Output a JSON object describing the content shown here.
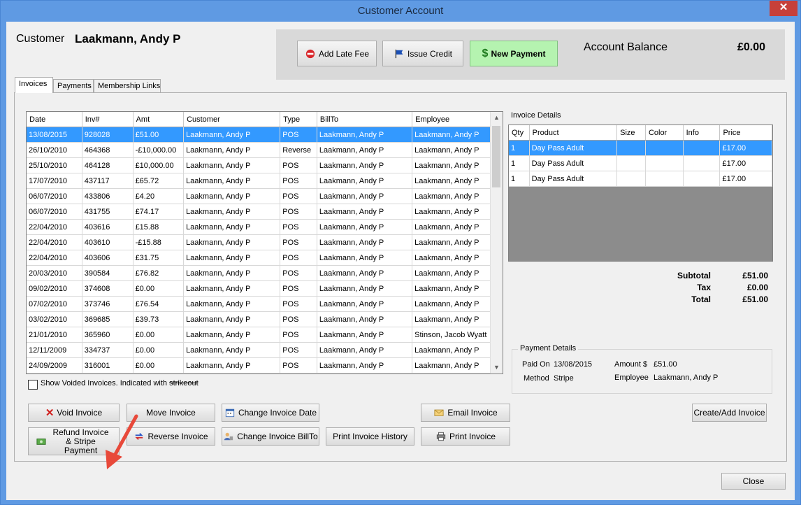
{
  "window": {
    "title": "Customer Account"
  },
  "customer": {
    "label": "Customer",
    "name": "Laakmann, Andy P"
  },
  "toolbar": {
    "add_late_fee": "Add Late Fee",
    "issue_credit": "Issue Credit",
    "new_payment": "New Payment"
  },
  "balance": {
    "label": "Account Balance",
    "value": "£0.00"
  },
  "tabs": [
    {
      "label": "Invoices"
    },
    {
      "label": "Payments"
    },
    {
      "label": "Membership Links"
    }
  ],
  "invoices": {
    "columns": [
      "Date",
      "Inv#",
      "Amt",
      "Customer",
      "Type",
      "BillTo",
      "Employee"
    ],
    "rows": [
      [
        "13/08/2015",
        "928028",
        "£51.00",
        "Laakmann, Andy P",
        "POS",
        "Laakmann, Andy P",
        "Laakmann, Andy P"
      ],
      [
        "26/10/2010",
        "464368",
        "-£10,000.00",
        "Laakmann, Andy P",
        "Reverse",
        "Laakmann, Andy P",
        "Laakmann, Andy P"
      ],
      [
        "25/10/2010",
        "464128",
        "£10,000.00",
        "Laakmann, Andy P",
        "POS",
        "Laakmann, Andy P",
        "Laakmann, Andy P"
      ],
      [
        "17/07/2010",
        "437117",
        "£65.72",
        "Laakmann, Andy P",
        "POS",
        "Laakmann, Andy P",
        "Laakmann, Andy P"
      ],
      [
        "06/07/2010",
        "433806",
        "£4.20",
        "Laakmann, Andy P",
        "POS",
        "Laakmann, Andy P",
        "Laakmann, Andy P"
      ],
      [
        "06/07/2010",
        "431755",
        "£74.17",
        "Laakmann, Andy P",
        "POS",
        "Laakmann, Andy P",
        "Laakmann, Andy P"
      ],
      [
        "22/04/2010",
        "403616",
        "£15.88",
        "Laakmann, Andy P",
        "POS",
        "Laakmann, Andy P",
        "Laakmann, Andy P"
      ],
      [
        "22/04/2010",
        "403610",
        "-£15.88",
        "Laakmann, Andy P",
        "POS",
        "Laakmann, Andy P",
        "Laakmann, Andy P"
      ],
      [
        "22/04/2010",
        "403606",
        "£31.75",
        "Laakmann, Andy P",
        "POS",
        "Laakmann, Andy P",
        "Laakmann, Andy P"
      ],
      [
        "20/03/2010",
        "390584",
        "£76.82",
        "Laakmann, Andy P",
        "POS",
        "Laakmann, Andy P",
        "Laakmann, Andy P"
      ],
      [
        "09/02/2010",
        "374608",
        "£0.00",
        "Laakmann, Andy P",
        "POS",
        "Laakmann, Andy P",
        "Laakmann, Andy P"
      ],
      [
        "07/02/2010",
        "373746",
        "£76.54",
        "Laakmann, Andy P",
        "POS",
        "Laakmann, Andy P",
        "Laakmann, Andy P"
      ],
      [
        "03/02/2010",
        "369685",
        "£39.73",
        "Laakmann, Andy P",
        "POS",
        "Laakmann, Andy P",
        "Laakmann, Andy P"
      ],
      [
        "21/01/2010",
        "365960",
        "£0.00",
        "Laakmann, Andy P",
        "POS",
        "Laakmann, Andy P",
        "Stinson, Jacob Wyatt"
      ],
      [
        "12/11/2009",
        "334737",
        "£0.00",
        "Laakmann, Andy P",
        "POS",
        "Laakmann, Andy P",
        "Laakmann, Andy P"
      ],
      [
        "24/09/2009",
        "316001",
        "£0.00",
        "Laakmann, Andy P",
        "POS",
        "Laakmann, Andy P",
        "Laakmann, Andy P"
      ]
    ]
  },
  "details": {
    "title": "Invoice Details",
    "columns": [
      "Qty",
      "Product",
      "Size",
      "Color",
      "Info",
      "Price"
    ],
    "rows": [
      [
        "1",
        "Day Pass Adult",
        "",
        "",
        "",
        "£17.00"
      ],
      [
        "1",
        "Day Pass Adult",
        "",
        "",
        "",
        "£17.00"
      ],
      [
        "1",
        "Day Pass Adult",
        "",
        "",
        "",
        "£17.00"
      ]
    ]
  },
  "totals": {
    "subtotal_label": "Subtotal",
    "subtotal": "£51.00",
    "tax_label": "Tax",
    "tax": "£0.00",
    "total_label": "Total",
    "total": "£51.00"
  },
  "payment": {
    "legend": "Payment Details",
    "paid_on_label": "Paid On",
    "paid_on": "13/08/2015",
    "amount_label": "Amount $",
    "amount": "£51.00",
    "method_label": "Method",
    "method": "Stripe",
    "employee_label": "Employee",
    "employee": "Laakmann, Andy P"
  },
  "voided": {
    "label_a": "Show Voided Invoices. Indicated with",
    "label_b": "strikeout"
  },
  "actions": {
    "void": "Void Invoice",
    "move": "Move Invoice",
    "change_date": "Change Invoice Date",
    "email": "Email Invoice",
    "create": "Create/Add Invoice",
    "refund": "Refund Invoice & Stripe Payment",
    "reverse": "Reverse Invoice",
    "change_billto": "Change Invoice BillTo",
    "print_history": "Print Invoice History",
    "print": "Print Invoice",
    "close": "Close"
  }
}
